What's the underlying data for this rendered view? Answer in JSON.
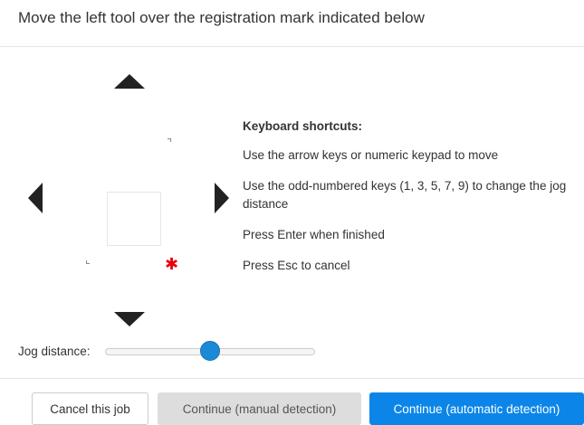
{
  "title": "Move the left tool over the registration mark indicated below",
  "shortcuts": {
    "heading": "Keyboard shortcuts:",
    "lines": [
      "Use the arrow keys or numeric keypad to move",
      "Use the odd-numbered keys (1, 3, 5, 7, 9) to change the jog distance",
      "Press Enter when finished",
      "Press Esc to cancel"
    ]
  },
  "jog": {
    "label": "Jog distance:",
    "value_fraction": 0.5
  },
  "buttons": {
    "cancel": "Cancel this job",
    "manual": "Continue (manual detection)",
    "auto": "Continue (automatic detection)"
  },
  "icons": {
    "up": "arrow-up-icon",
    "down": "arrow-down-icon",
    "left": "arrow-left-icon",
    "right": "arrow-right-icon",
    "registration_mark": "asterisk-icon"
  },
  "colors": {
    "accent": "#0b86e8",
    "registration_mark": "#e8000b",
    "arrows": "#222222"
  },
  "registration_mark_glyph": "✱"
}
